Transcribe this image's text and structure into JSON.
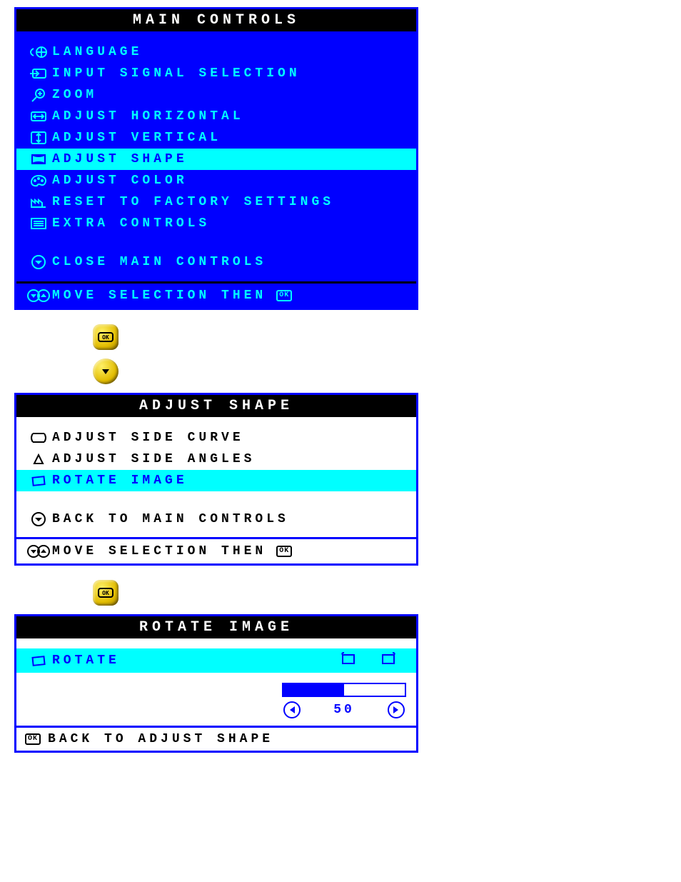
{
  "mainControls": {
    "title": "MAIN CONTROLS",
    "items": [
      {
        "label": "LANGUAGE"
      },
      {
        "label": "INPUT SIGNAL SELECTION"
      },
      {
        "label": "ZOOM"
      },
      {
        "label": "ADJUST HORIZONTAL"
      },
      {
        "label": "ADJUST VERTICAL"
      },
      {
        "label": "ADJUST SHAPE"
      },
      {
        "label": "ADJUST COLOR"
      },
      {
        "label": "RESET TO FACTORY SETTINGS"
      },
      {
        "label": "EXTRA CONTROLS"
      }
    ],
    "close": "CLOSE MAIN CONTROLS",
    "footer": "MOVE SELECTION THEN",
    "ok": "OK"
  },
  "adjustShape": {
    "title": "ADJUST SHAPE",
    "items": [
      {
        "label": "ADJUST SIDE CURVE"
      },
      {
        "label": "ADJUST SIDE ANGLES"
      },
      {
        "label": "ROTATE IMAGE"
      }
    ],
    "back": "BACK TO MAIN CONTROLS",
    "footer": "MOVE SELECTION THEN",
    "ok": "OK"
  },
  "rotateImage": {
    "title": "ROTATE IMAGE",
    "item": "ROTATE",
    "value": "50",
    "back": "BACK TO ADJUST SHAPE",
    "ok": "OK"
  }
}
